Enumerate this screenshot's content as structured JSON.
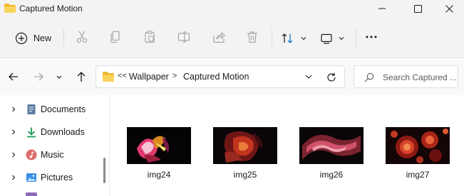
{
  "window": {
    "title": "Captured Motion"
  },
  "toolbar": {
    "new_label": "New",
    "icons": [
      "cut-icon",
      "copy-icon",
      "paste-icon",
      "rename-icon",
      "share-icon",
      "delete-icon",
      "sort-icon",
      "view-icon",
      "more-icon"
    ]
  },
  "address": {
    "overflow": "<<",
    "crumbs": [
      "Wallpaper",
      "Captured Motion"
    ],
    "separator": ">"
  },
  "search": {
    "placeholder": "Search Captured ..."
  },
  "sidebar": {
    "items": [
      {
        "label": "Documents",
        "icon": "document-icon"
      },
      {
        "label": "Downloads",
        "icon": "download-icon"
      },
      {
        "label": "Music",
        "icon": "music-icon"
      },
      {
        "label": "Pictures",
        "icon": "pictures-icon"
      }
    ]
  },
  "files": [
    {
      "name": "img24"
    },
    {
      "name": "img25"
    },
    {
      "name": "img26"
    },
    {
      "name": "img27"
    }
  ],
  "colors": {
    "folder": "#f7c948",
    "accent": "#0067c0",
    "download": "#1f9d55"
  }
}
